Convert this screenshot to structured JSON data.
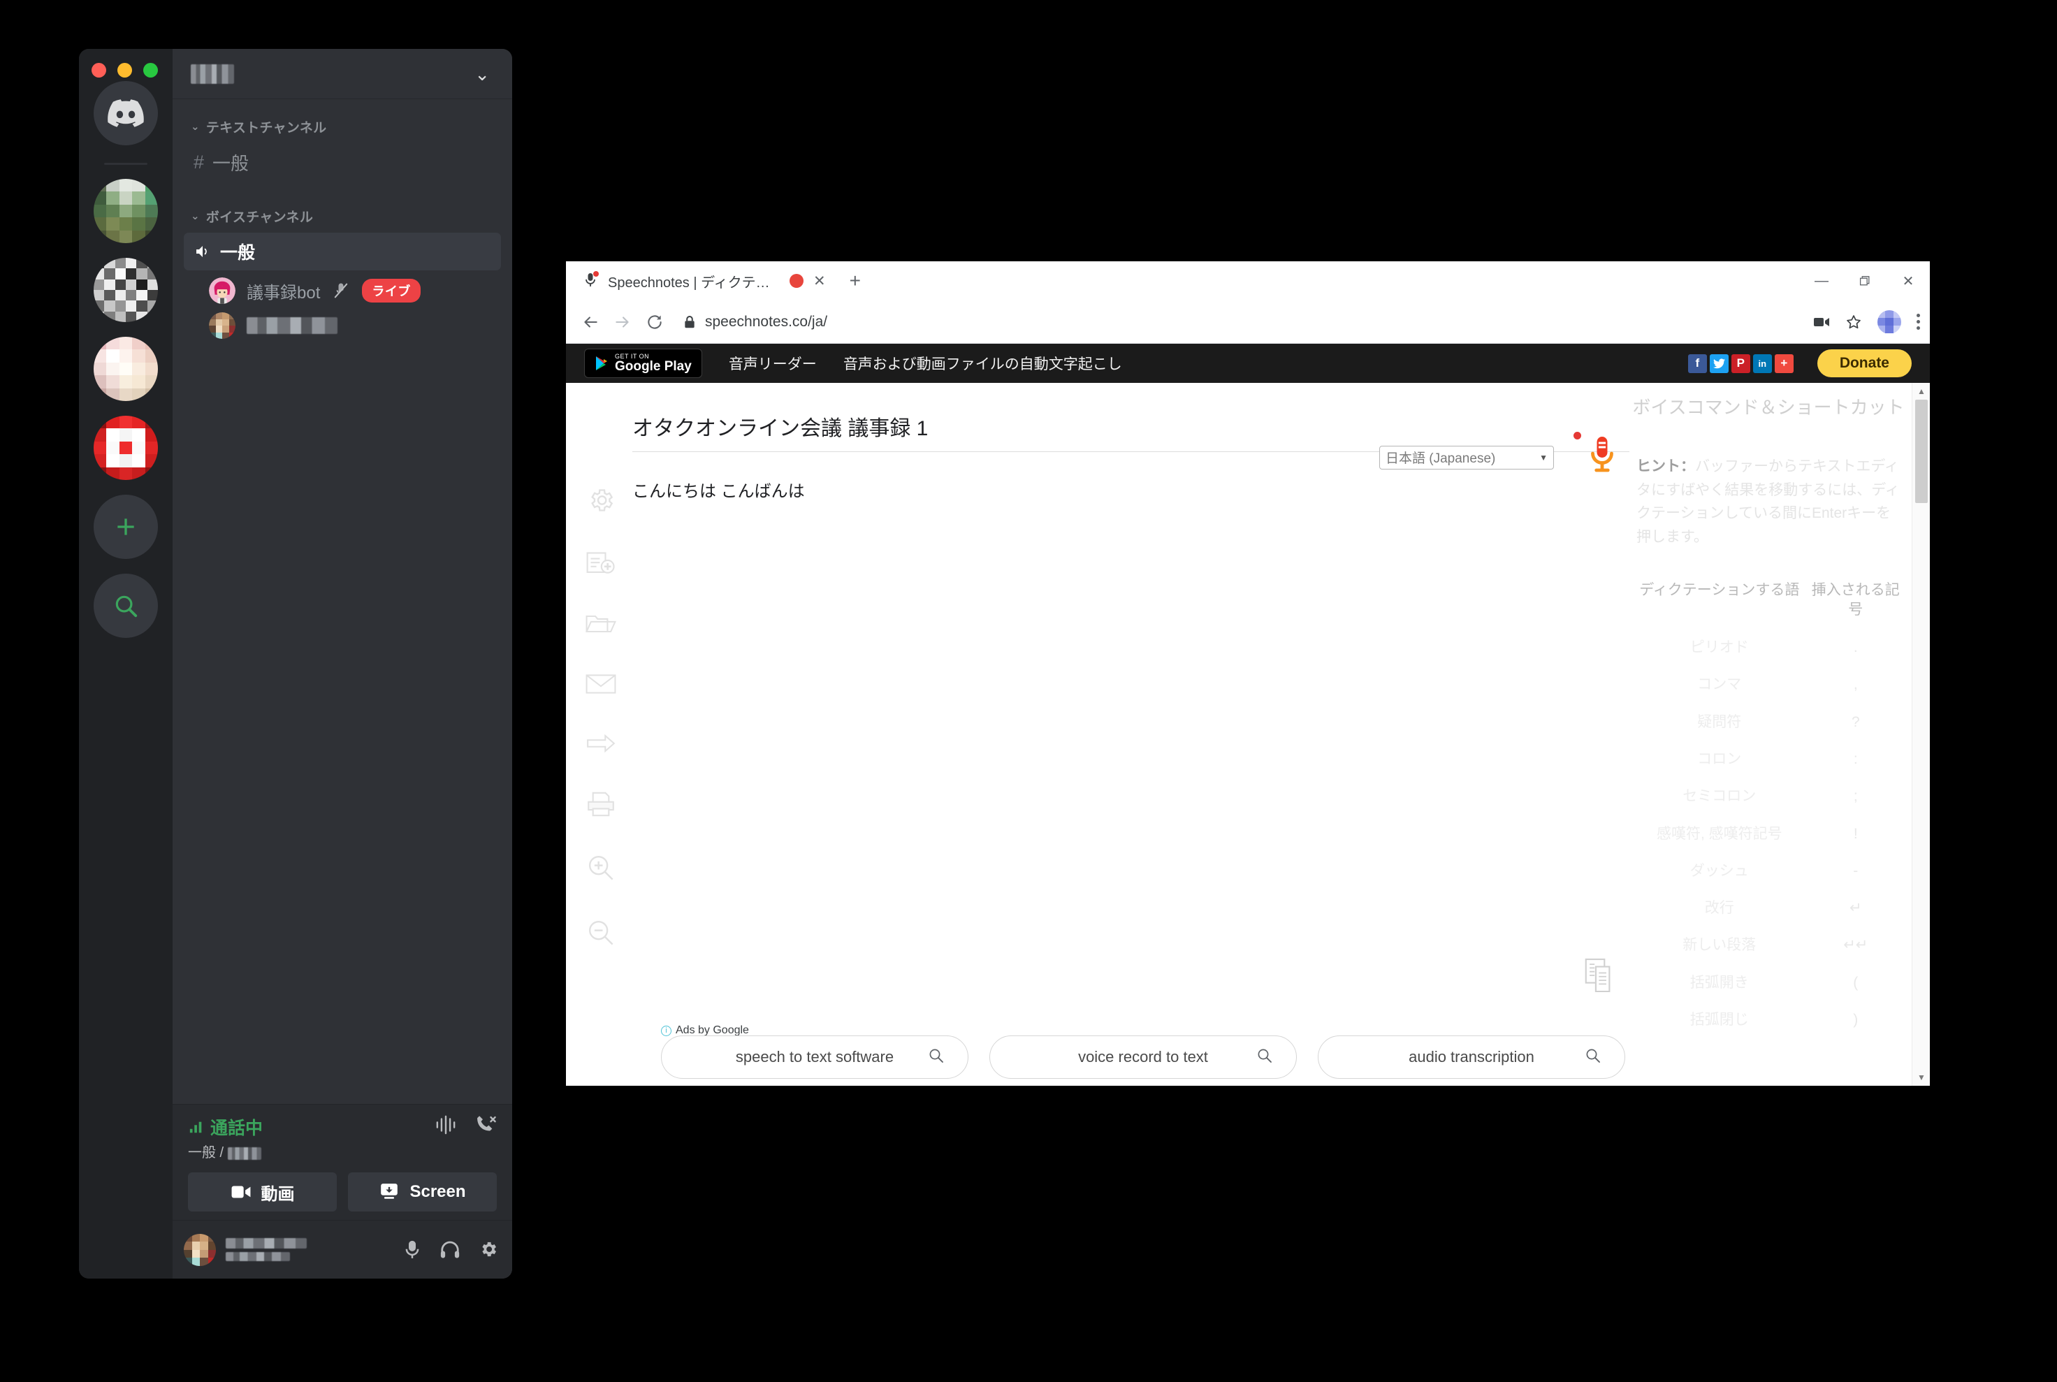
{
  "discord": {
    "window_controls": [
      "close",
      "minimize",
      "maximize"
    ],
    "server_rail": {
      "home_icon": "discord-home-icon",
      "servers": [
        {
          "name_hidden": true,
          "selected": true
        },
        {
          "name_hidden": true,
          "selected": false
        },
        {
          "name_hidden": true,
          "selected": false
        },
        {
          "name_hidden": true,
          "selected": false
        }
      ],
      "add_server_label": "+",
      "explore_label": "explore-servers-icon"
    },
    "server_header": {
      "name_redacted": true,
      "chevron": "⌄"
    },
    "categories": [
      {
        "label": "テキストチャンネル",
        "caret": "⌄",
        "channels": [
          {
            "icon": "#",
            "name": "一般",
            "active": false
          }
        ]
      },
      {
        "label": "ボイスチャンネル",
        "caret": "⌄",
        "channels": [
          {
            "icon": "speaker-icon",
            "name": "一般",
            "active": true
          }
        ]
      }
    ],
    "members": [
      {
        "name": "議事録bot",
        "muted": true,
        "badge": "ライブ",
        "redacted": false
      },
      {
        "name": "",
        "muted": false,
        "badge": "",
        "redacted": true
      }
    ],
    "voice_panel": {
      "status": "通話中",
      "channel": "一般 /",
      "channel_redacted": true,
      "icons": [
        "signal-icon",
        "disconnect-call-icon"
      ],
      "buttons": [
        {
          "label": "動画",
          "icon": "video-camera-icon"
        },
        {
          "label": "Screen",
          "icon": "screen-share-icon"
        }
      ]
    },
    "user_bar": {
      "name_redacted": true,
      "icons": [
        "microphone-icon",
        "headphones-icon",
        "gear-icon"
      ]
    },
    "colors": {
      "rail_bg": "#202225",
      "sidebar_bg": "#2f3136",
      "panel_bg": "#292b2f",
      "accent_green": "#3ba55d",
      "live_red": "#ed4245"
    }
  },
  "browser": {
    "tab": {
      "title": "Speechnotes | ディクテーション",
      "favicon": "microphone-icon",
      "recording_indicator": true,
      "close_label": "✕"
    },
    "new_tab_label": "+",
    "window_buttons": {
      "minimize": "—",
      "maximize": "▢",
      "close": "✕"
    },
    "toolbar": {
      "back": "←",
      "forward": "→",
      "reload": "⟳",
      "lock_icon": "lock-icon",
      "url": "speechnotes.co/ja/",
      "right_icons": [
        "camera-icon",
        "bookmark-star-icon",
        "profile-avatar",
        "chrome-menu-icon"
      ]
    }
  },
  "site": {
    "nav": {
      "google_play": {
        "small": "GET IT ON",
        "big": "Google Play"
      },
      "links": [
        "音声リーダー",
        "音声および動画ファイルの自動文字起こし"
      ],
      "social": [
        {
          "name": "facebook-icon",
          "glyph": "f",
          "color": "#3b5998"
        },
        {
          "name": "twitter-icon",
          "glyph": "t",
          "color": "#1da1f2"
        },
        {
          "name": "pinterest-icon",
          "glyph": "P",
          "color": "#cb2027"
        },
        {
          "name": "linkedin-icon",
          "glyph": "in",
          "color": "#0077b5"
        },
        {
          "name": "share-more-icon",
          "glyph": "+",
          "color": "#f04a3f"
        }
      ],
      "donate_label": "Donate"
    },
    "editor": {
      "title": "オタクオンライン会議 議事録 1",
      "body": "こんにちは  こんばんは",
      "language_value": "日本語 (Japanese)",
      "language_caret": "▼",
      "mic_state": "recording",
      "copy_icon": "copy-documents-icon"
    },
    "left_tools": [
      "settings-gear-icon",
      "new-document-icon",
      "open-folder-icon",
      "email-icon",
      "export-arrow-icon",
      "print-icon",
      "zoom-in-icon",
      "zoom-out-icon"
    ],
    "voice_commands_panel": {
      "title": "ボイスコマンド＆ショートカット",
      "hint_label": "ヒント：",
      "hint_text": "バッファーからテキストエディタにすばやく結果を移動するには、ディクテーションしている間にEnterキーを押します。",
      "table": {
        "headers": [
          "ディクテーションする語",
          "挿入される記号"
        ],
        "rows": [
          {
            "word": "ピリオド",
            "symbol": "."
          },
          {
            "word": "コンマ",
            "symbol": ","
          },
          {
            "word": "疑問符",
            "symbol": "?"
          },
          {
            "word": "コロン",
            "symbol": ":"
          },
          {
            "word": "セミコロン",
            "symbol": ";"
          },
          {
            "word": "感嘆符, 感嘆符記号",
            "symbol": "!"
          },
          {
            "word": "ダッシュ",
            "symbol": "-"
          },
          {
            "word": "改行",
            "symbol": "↵"
          },
          {
            "word": "新しい段落",
            "symbol": "↵↵"
          },
          {
            "word": "括弧開き",
            "symbol": "("
          },
          {
            "word": "括弧閉じ",
            "symbol": ")"
          }
        ]
      }
    },
    "ads": {
      "label": "Ads by Google",
      "pills": [
        "speech to text software",
        "voice record to text",
        "audio transcription"
      ]
    }
  }
}
